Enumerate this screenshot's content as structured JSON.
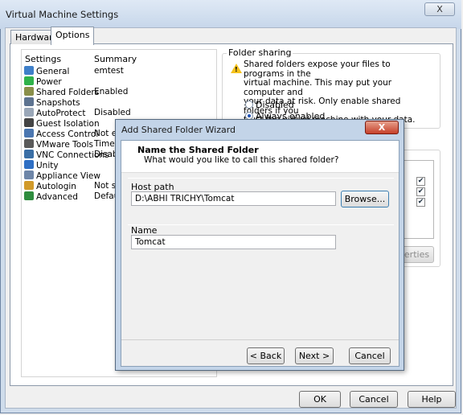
{
  "window": {
    "title": "Virtual Machine Settings",
    "close_glyph": "X"
  },
  "tabs": [
    {
      "label": "Hardware"
    },
    {
      "label": "Options"
    }
  ],
  "settings": {
    "col_settings": "Settings",
    "col_summary": "Summary",
    "rows": [
      {
        "label": "General",
        "summary": "emtest",
        "icon": "general-icon",
        "color": "#3f7fc9"
      },
      {
        "label": "Power",
        "summary": "",
        "icon": "power-play-icon",
        "color": "#2fb24a"
      },
      {
        "label": "Shared Folders",
        "summary": "Enabled",
        "icon": "shared-folders-icon",
        "color": "#8a8f4a"
      },
      {
        "label": "Snapshots",
        "summary": "",
        "icon": "snapshots-icon",
        "color": "#5d7390"
      },
      {
        "label": "AutoProtect",
        "summary": "Disabled",
        "icon": "autoprotect-icon",
        "color": "#9aa7b8"
      },
      {
        "label": "Guest Isolation",
        "summary": "",
        "icon": "guest-isolation-icon",
        "color": "#444444"
      },
      {
        "label": "Access Control",
        "summary": "Not enc",
        "icon": "access-control-icon",
        "color": "#4a76b0"
      },
      {
        "label": "VMware Tools",
        "summary": "Time sy",
        "icon": "vmware-tools-icon",
        "color": "#5a5a5a"
      },
      {
        "label": "VNC Connections",
        "summary": "Disable",
        "icon": "vnc-connections-icon",
        "color": "#3a6ea5"
      },
      {
        "label": "Unity",
        "summary": "",
        "icon": "unity-icon",
        "color": "#2f6fc4"
      },
      {
        "label": "Appliance View",
        "summary": "",
        "icon": "appliance-view-icon",
        "color": "#6e86a8"
      },
      {
        "label": "Autologin",
        "summary": "Not sup",
        "icon": "autologin-icon",
        "color": "#d19a2a"
      },
      {
        "label": "Advanced",
        "summary": "Default",
        "icon": "advanced-icon",
        "color": "#2e8c3e"
      }
    ]
  },
  "folder_sharing": {
    "legend": "Folder sharing",
    "lines": [
      "Shared folders expose your files to programs in the",
      "virtual machine. This may put your computer and",
      "your data at risk. Only enable shared folders if you",
      "trust the virtual machine with your data."
    ],
    "options": [
      {
        "label": "Disabled",
        "selected": false
      },
      {
        "label": "Always enabled",
        "selected": true
      }
    ]
  },
  "folders": {
    "properties_label": "perties",
    "checked": [
      true,
      true,
      true
    ]
  },
  "buttons": {
    "ok": "OK",
    "cancel": "Cancel",
    "help": "Help"
  },
  "dialog": {
    "title": "Add Shared Folder Wizard",
    "close_glyph": "X",
    "heading": "Name the Shared Folder",
    "subheading": "What would you like to call this shared folder?",
    "host_path_label": "Host path",
    "host_path_value": "D:\\ABHI TRICHY\\Tomcat",
    "browse_label": "Browse...",
    "name_label": "Name",
    "name_value": "Tomcat",
    "back_label": "< Back",
    "next_label": "Next >",
    "cancel_label": "Cancel"
  }
}
